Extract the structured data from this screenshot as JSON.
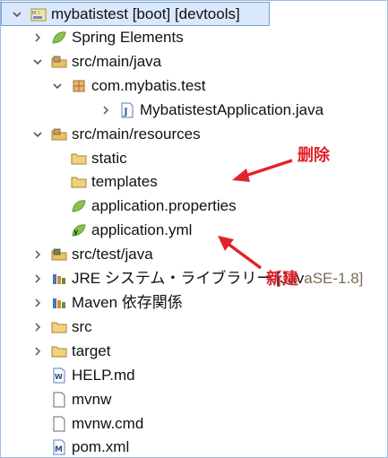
{
  "tree": {
    "items": [
      {
        "label": "mybatistest [boot] [devtools]",
        "icon": "project-icon",
        "expanded": true
      },
      {
        "label": "Spring Elements",
        "icon": "spring-leaf-icon",
        "expanded": false
      },
      {
        "label": "src/main/java",
        "icon": "source-folder-icon",
        "expanded": true
      },
      {
        "label": "com.mybatis.test",
        "icon": "package-icon",
        "expanded": true
      },
      {
        "label": "MybatistestApplication.java",
        "icon": "java-file-icon",
        "expanded": false
      },
      {
        "label": "src/main/resources",
        "icon": "source-folder-icon",
        "expanded": true
      },
      {
        "label": "static",
        "icon": "folder-icon"
      },
      {
        "label": "templates",
        "icon": "folder-icon"
      },
      {
        "label": "application.properties",
        "icon": "spring-properties-icon"
      },
      {
        "label": "application.yml",
        "icon": "spring-yml-icon"
      },
      {
        "label": "src/test/java",
        "icon": "source-folder-icon",
        "expanded": false
      },
      {
        "label": "JRE システム・ライブラリー [Jav",
        "label_tail": "aSE-1.8]",
        "icon": "library-icon",
        "expanded": false
      },
      {
        "label": "Maven 依存関係",
        "icon": "library-icon",
        "expanded": false
      },
      {
        "label": "src",
        "icon": "folder-icon",
        "expanded": false
      },
      {
        "label": "target",
        "icon": "folder-icon",
        "expanded": false
      },
      {
        "label": "HELP.md",
        "icon": "text-file-icon"
      },
      {
        "label": "mvnw",
        "icon": "file-icon"
      },
      {
        "label": "mvnw.cmd",
        "icon": "file-icon"
      },
      {
        "label": "pom.xml",
        "icon": "xml-file-icon"
      }
    ]
  },
  "annotations": {
    "delete_label": "删除",
    "new_label": "新建"
  },
  "colors": {
    "annotation_red": "#e1232b",
    "selection_bg": "#d9e8fb",
    "folder_yellow": "#e8c165",
    "spring_green": "#6db33f"
  }
}
